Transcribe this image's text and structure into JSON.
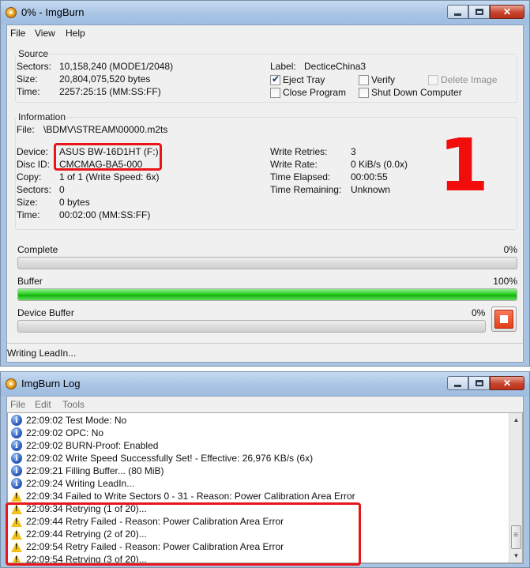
{
  "main_window": {
    "title": "0% - ImgBurn",
    "menu": [
      "File",
      "View",
      "Help"
    ],
    "source": {
      "label": "Source",
      "sectors_label": "Sectors:",
      "sectors_value": "10,158,240 (MODE1/2048)",
      "size_label": "Size:",
      "size_value": "20,804,075,520 bytes",
      "time_label": "Time:",
      "time_value": "2257:25:15 (MM:SS:FF)",
      "disc_label_label": "Label:",
      "disc_label_value": "DecticeChina3",
      "options": {
        "eject_tray": {
          "label": "Eject Tray",
          "checked": true
        },
        "verify": {
          "label": "Verify",
          "checked": false
        },
        "delete_image": {
          "label": "Delete Image",
          "checked": false,
          "disabled": true
        },
        "close_program": {
          "label": "Close Program",
          "checked": false
        },
        "shut_down": {
          "label": "Shut Down Computer",
          "checked": false
        }
      }
    },
    "information": {
      "label": "Information",
      "file_label": "File:",
      "file_value": "\\BDMV\\STREAM\\00000.m2ts",
      "device_label": "Device:",
      "device_value": "ASUS BW-16D1HT (F:)",
      "disc_id_label": "Disc ID:",
      "disc_id_value": "CMCMAG-BA5-000",
      "copy_label": "Copy:",
      "copy_value": "1 of 1 (Write Speed: 6x)",
      "sectors_label": "Sectors:",
      "sectors_value": "0",
      "size_label": "Size:",
      "size_value": "0 bytes",
      "time_label": "Time:",
      "time_value": "00:02:00 (MM:SS:FF)",
      "write_retries_label": "Write Retries:",
      "write_retries_value": "3",
      "write_rate_label": "Write Rate:",
      "write_rate_value": "0 KiB/s (0.0x)",
      "time_elapsed_label": "Time Elapsed:",
      "time_elapsed_value": "00:00:55",
      "time_remaining_label": "Time Remaining:",
      "time_remaining_value": "Unknown"
    },
    "annotation_number": "1",
    "progress": {
      "complete_label": "Complete",
      "complete_percent": "0%",
      "complete_value": 0,
      "buffer_label": "Buffer",
      "buffer_percent": "100%",
      "buffer_value": 100,
      "device_buffer_label": "Device Buffer",
      "device_buffer_percent": "0%",
      "device_buffer_value": 0
    },
    "status": "Writing LeadIn..."
  },
  "log_window": {
    "title": "ImgBurn Log",
    "menu": [
      "File",
      "Edit",
      "Tools"
    ],
    "entries": [
      {
        "type": "info",
        "text": "22:09:02 Test Mode: No"
      },
      {
        "type": "info",
        "text": "22:09:02 OPC: No"
      },
      {
        "type": "info",
        "text": "22:09:02 BURN-Proof: Enabled"
      },
      {
        "type": "info",
        "text": "22:09:02 Write Speed Successfully Set! - Effective: 26,976 KB/s (6x)"
      },
      {
        "type": "info",
        "text": "22:09:21 Filling Buffer... (80 MiB)"
      },
      {
        "type": "info",
        "text": "22:09:24 Writing LeadIn..."
      },
      {
        "type": "warning",
        "text": "22:09:34 Failed to Write Sectors 0 - 31 - Reason: Power Calibration Area Error"
      },
      {
        "type": "warning",
        "text": "22:09:34 Retrying (1 of 20)..."
      },
      {
        "type": "warning",
        "text": "22:09:44 Retry Failed - Reason: Power Calibration Area Error"
      },
      {
        "type": "warning",
        "text": "22:09:44 Retrying (2 of 20)..."
      },
      {
        "type": "warning",
        "text": "22:09:54 Retry Failed - Reason: Power Calibration Area Error"
      },
      {
        "type": "warning",
        "text": "22:09:54 Retrying (3 of 20)..."
      }
    ]
  },
  "colors": {
    "annotation_red": "#e8151a",
    "progress_green": "#2bcf24",
    "stop_button": "#e23d17"
  }
}
